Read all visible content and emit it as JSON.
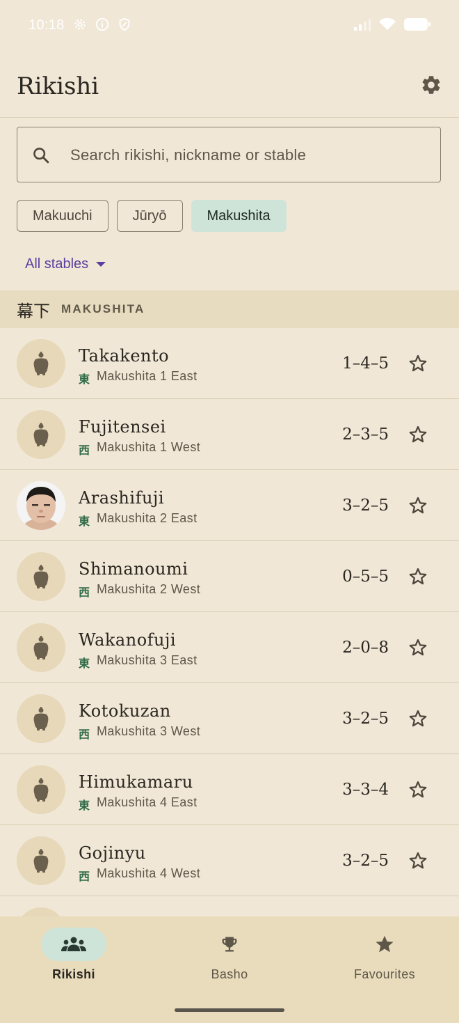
{
  "status_bar": {
    "time": "10:18"
  },
  "header": {
    "title": "Rikishi"
  },
  "search": {
    "placeholder": "Search rikishi, nickname or stable",
    "value": ""
  },
  "divisions": [
    {
      "label": "Makuuchi",
      "selected": false
    },
    {
      "label": "Jūryō",
      "selected": false
    },
    {
      "label": "Makushita",
      "selected": true
    }
  ],
  "stables_filter": {
    "label": "All stables"
  },
  "section": {
    "kanji": "幕下",
    "label": "MAKUSHITA"
  },
  "rikishi": [
    {
      "name": "Takakento",
      "side_kanji": "東",
      "rank": "Makushita 1 East",
      "record": "1–4–5",
      "photo": false
    },
    {
      "name": "Fujitensei",
      "side_kanji": "西",
      "rank": "Makushita 1 West",
      "record": "2–3–5",
      "photo": false
    },
    {
      "name": "Arashifuji",
      "side_kanji": "東",
      "rank": "Makushita 2 East",
      "record": "3–2–5",
      "photo": true
    },
    {
      "name": "Shimanoumi",
      "side_kanji": "西",
      "rank": "Makushita 2 West",
      "record": "0–5–5",
      "photo": false
    },
    {
      "name": "Wakanofuji",
      "side_kanji": "東",
      "rank": "Makushita 3 East",
      "record": "2–0–8",
      "photo": false
    },
    {
      "name": "Kotokuzan",
      "side_kanji": "西",
      "rank": "Makushita 3 West",
      "record": "3–2–5",
      "photo": false
    },
    {
      "name": "Himukamaru",
      "side_kanji": "東",
      "rank": "Makushita 4 East",
      "record": "3–3–4",
      "photo": false
    },
    {
      "name": "Gojinyu",
      "side_kanji": "西",
      "rank": "Makushita 4 West",
      "record": "3–2–5",
      "photo": false
    }
  ],
  "bottom_nav": [
    {
      "label": "Rikishi",
      "icon": "group-icon",
      "active": true
    },
    {
      "label": "Basho",
      "icon": "trophy-icon",
      "active": false
    },
    {
      "label": "Favourites",
      "icon": "star-filled-icon",
      "active": false
    }
  ],
  "colors": {
    "background": "#f0e7d6",
    "accent": "#cfe4d9",
    "link": "#5b3fa0",
    "side_kanji": "#2f6b47"
  }
}
